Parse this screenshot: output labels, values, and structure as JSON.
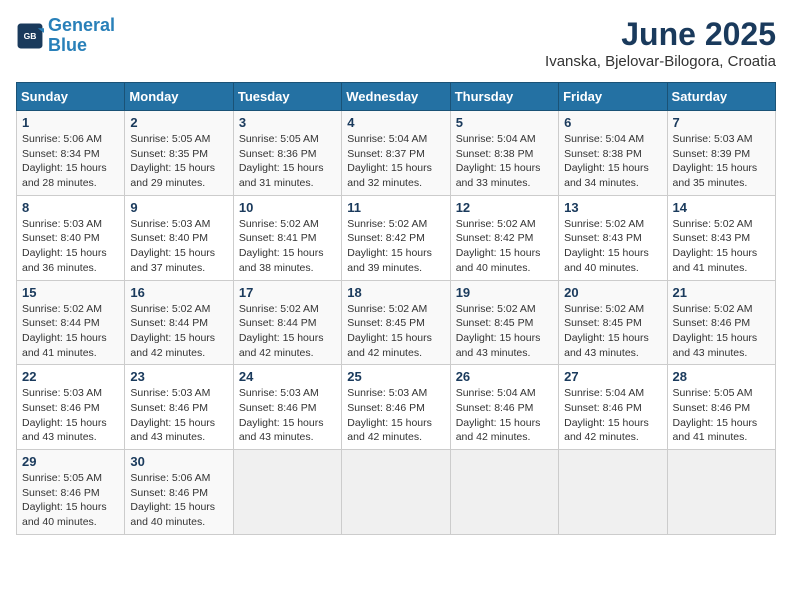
{
  "header": {
    "logo_line1": "General",
    "logo_line2": "Blue",
    "month_year": "June 2025",
    "location": "Ivanska, Bjelovar-Bilogora, Croatia"
  },
  "days_of_week": [
    "Sunday",
    "Monday",
    "Tuesday",
    "Wednesday",
    "Thursday",
    "Friday",
    "Saturday"
  ],
  "weeks": [
    [
      {
        "day": 1,
        "sunrise": "Sunrise: 5:06 AM",
        "sunset": "Sunset: 8:34 PM",
        "daylight": "Daylight: 15 hours and 28 minutes."
      },
      {
        "day": 2,
        "sunrise": "Sunrise: 5:05 AM",
        "sunset": "Sunset: 8:35 PM",
        "daylight": "Daylight: 15 hours and 29 minutes."
      },
      {
        "day": 3,
        "sunrise": "Sunrise: 5:05 AM",
        "sunset": "Sunset: 8:36 PM",
        "daylight": "Daylight: 15 hours and 31 minutes."
      },
      {
        "day": 4,
        "sunrise": "Sunrise: 5:04 AM",
        "sunset": "Sunset: 8:37 PM",
        "daylight": "Daylight: 15 hours and 32 minutes."
      },
      {
        "day": 5,
        "sunrise": "Sunrise: 5:04 AM",
        "sunset": "Sunset: 8:38 PM",
        "daylight": "Daylight: 15 hours and 33 minutes."
      },
      {
        "day": 6,
        "sunrise": "Sunrise: 5:04 AM",
        "sunset": "Sunset: 8:38 PM",
        "daylight": "Daylight: 15 hours and 34 minutes."
      },
      {
        "day": 7,
        "sunrise": "Sunrise: 5:03 AM",
        "sunset": "Sunset: 8:39 PM",
        "daylight": "Daylight: 15 hours and 35 minutes."
      }
    ],
    [
      {
        "day": 8,
        "sunrise": "Sunrise: 5:03 AM",
        "sunset": "Sunset: 8:40 PM",
        "daylight": "Daylight: 15 hours and 36 minutes."
      },
      {
        "day": 9,
        "sunrise": "Sunrise: 5:03 AM",
        "sunset": "Sunset: 8:40 PM",
        "daylight": "Daylight: 15 hours and 37 minutes."
      },
      {
        "day": 10,
        "sunrise": "Sunrise: 5:02 AM",
        "sunset": "Sunset: 8:41 PM",
        "daylight": "Daylight: 15 hours and 38 minutes."
      },
      {
        "day": 11,
        "sunrise": "Sunrise: 5:02 AM",
        "sunset": "Sunset: 8:42 PM",
        "daylight": "Daylight: 15 hours and 39 minutes."
      },
      {
        "day": 12,
        "sunrise": "Sunrise: 5:02 AM",
        "sunset": "Sunset: 8:42 PM",
        "daylight": "Daylight: 15 hours and 40 minutes."
      },
      {
        "day": 13,
        "sunrise": "Sunrise: 5:02 AM",
        "sunset": "Sunset: 8:43 PM",
        "daylight": "Daylight: 15 hours and 40 minutes."
      },
      {
        "day": 14,
        "sunrise": "Sunrise: 5:02 AM",
        "sunset": "Sunset: 8:43 PM",
        "daylight": "Daylight: 15 hours and 41 minutes."
      }
    ],
    [
      {
        "day": 15,
        "sunrise": "Sunrise: 5:02 AM",
        "sunset": "Sunset: 8:44 PM",
        "daylight": "Daylight: 15 hours and 41 minutes."
      },
      {
        "day": 16,
        "sunrise": "Sunrise: 5:02 AM",
        "sunset": "Sunset: 8:44 PM",
        "daylight": "Daylight: 15 hours and 42 minutes."
      },
      {
        "day": 17,
        "sunrise": "Sunrise: 5:02 AM",
        "sunset": "Sunset: 8:44 PM",
        "daylight": "Daylight: 15 hours and 42 minutes."
      },
      {
        "day": 18,
        "sunrise": "Sunrise: 5:02 AM",
        "sunset": "Sunset: 8:45 PM",
        "daylight": "Daylight: 15 hours and 42 minutes."
      },
      {
        "day": 19,
        "sunrise": "Sunrise: 5:02 AM",
        "sunset": "Sunset: 8:45 PM",
        "daylight": "Daylight: 15 hours and 43 minutes."
      },
      {
        "day": 20,
        "sunrise": "Sunrise: 5:02 AM",
        "sunset": "Sunset: 8:45 PM",
        "daylight": "Daylight: 15 hours and 43 minutes."
      },
      {
        "day": 21,
        "sunrise": "Sunrise: 5:02 AM",
        "sunset": "Sunset: 8:46 PM",
        "daylight": "Daylight: 15 hours and 43 minutes."
      }
    ],
    [
      {
        "day": 22,
        "sunrise": "Sunrise: 5:03 AM",
        "sunset": "Sunset: 8:46 PM",
        "daylight": "Daylight: 15 hours and 43 minutes."
      },
      {
        "day": 23,
        "sunrise": "Sunrise: 5:03 AM",
        "sunset": "Sunset: 8:46 PM",
        "daylight": "Daylight: 15 hours and 43 minutes."
      },
      {
        "day": 24,
        "sunrise": "Sunrise: 5:03 AM",
        "sunset": "Sunset: 8:46 PM",
        "daylight": "Daylight: 15 hours and 43 minutes."
      },
      {
        "day": 25,
        "sunrise": "Sunrise: 5:03 AM",
        "sunset": "Sunset: 8:46 PM",
        "daylight": "Daylight: 15 hours and 42 minutes."
      },
      {
        "day": 26,
        "sunrise": "Sunrise: 5:04 AM",
        "sunset": "Sunset: 8:46 PM",
        "daylight": "Daylight: 15 hours and 42 minutes."
      },
      {
        "day": 27,
        "sunrise": "Sunrise: 5:04 AM",
        "sunset": "Sunset: 8:46 PM",
        "daylight": "Daylight: 15 hours and 42 minutes."
      },
      {
        "day": 28,
        "sunrise": "Sunrise: 5:05 AM",
        "sunset": "Sunset: 8:46 PM",
        "daylight": "Daylight: 15 hours and 41 minutes."
      }
    ],
    [
      {
        "day": 29,
        "sunrise": "Sunrise: 5:05 AM",
        "sunset": "Sunset: 8:46 PM",
        "daylight": "Daylight: 15 hours and 40 minutes."
      },
      {
        "day": 30,
        "sunrise": "Sunrise: 5:06 AM",
        "sunset": "Sunset: 8:46 PM",
        "daylight": "Daylight: 15 hours and 40 minutes."
      },
      null,
      null,
      null,
      null,
      null
    ]
  ]
}
